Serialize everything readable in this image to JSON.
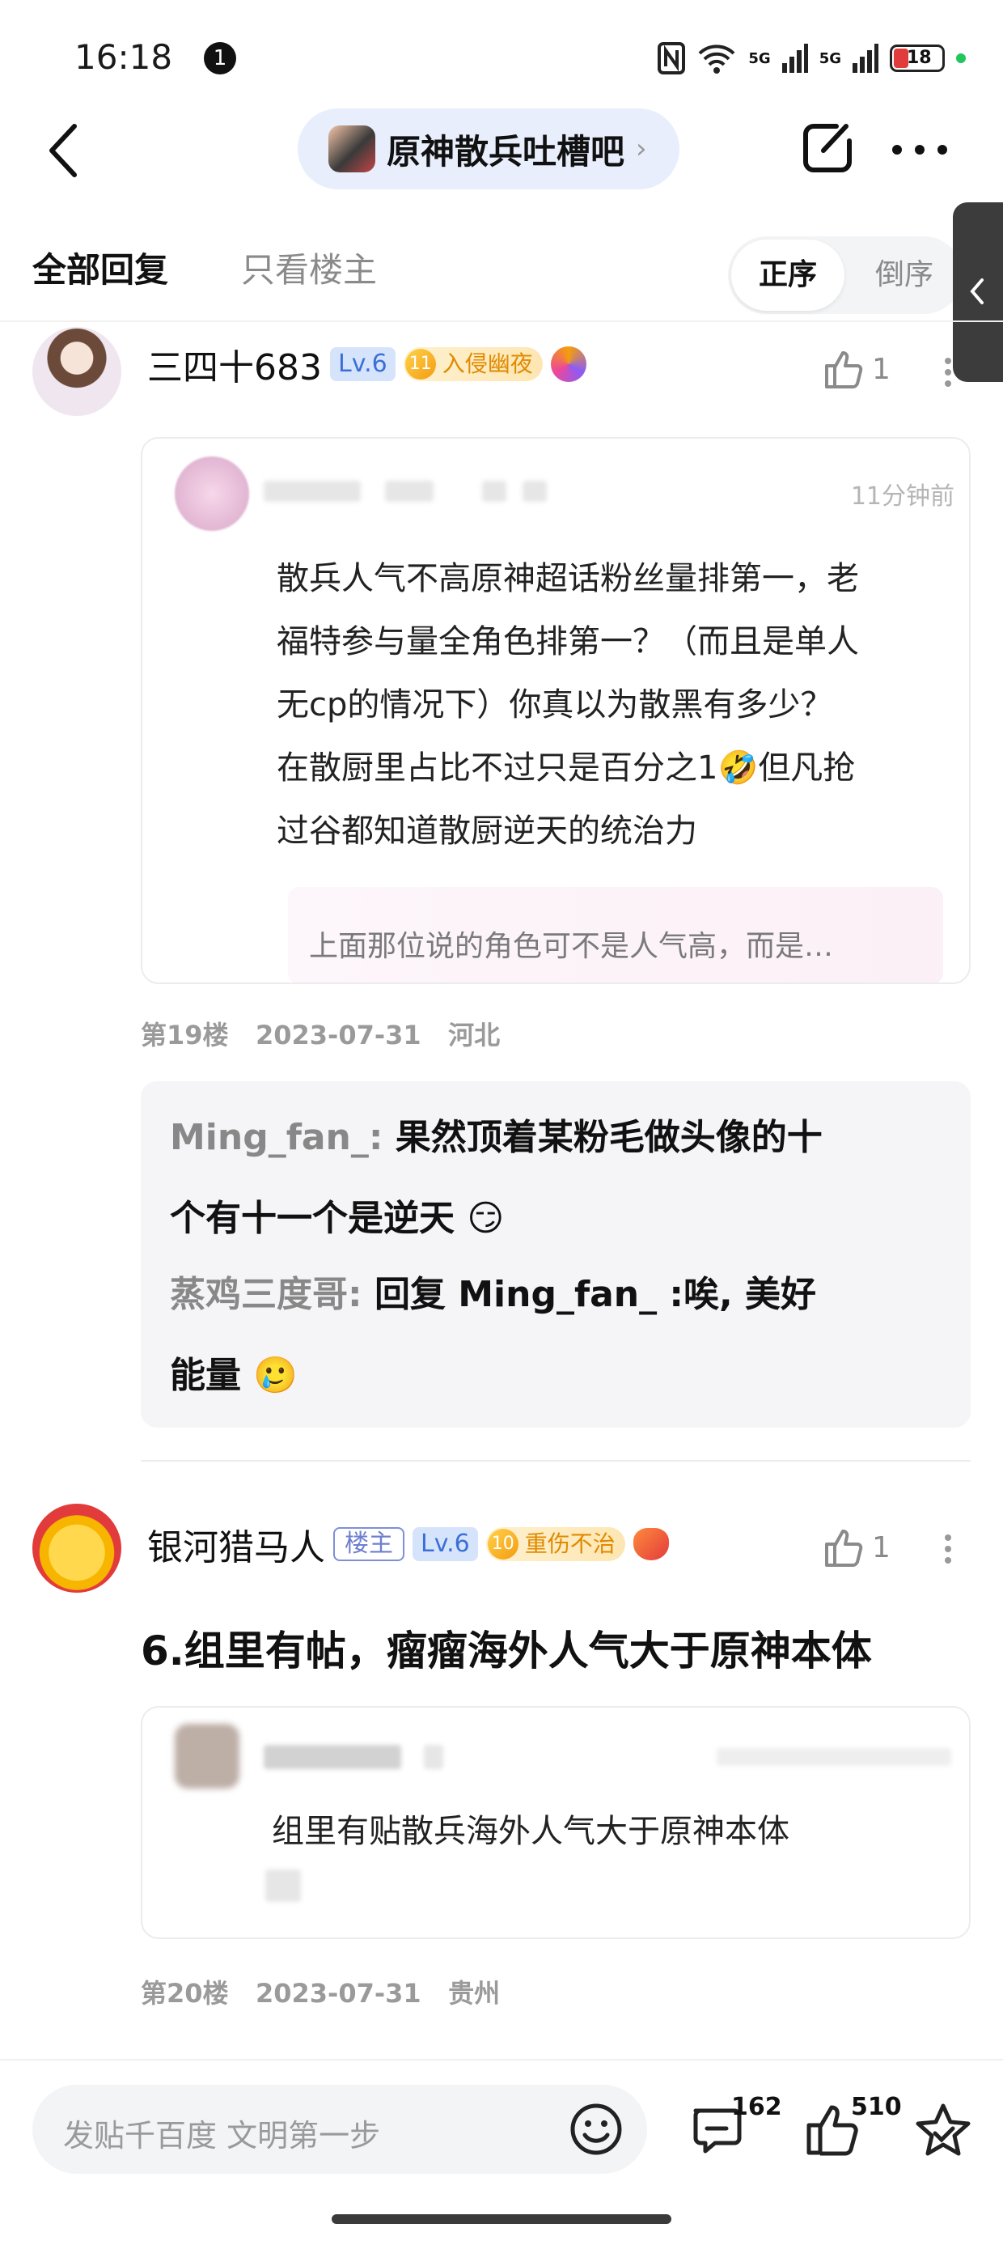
{
  "status_bar": {
    "time": "16:18",
    "notification_count": "1",
    "signal_1": "5G",
    "signal_2": "5G",
    "battery": "18"
  },
  "header": {
    "forum_name": "原神散兵吐槽吧",
    "chevron": "›"
  },
  "tabs": {
    "all_replies": "全部回复",
    "only_op": "只看楼主",
    "sort_asc": "正序",
    "sort_desc": "倒序"
  },
  "posts": [
    {
      "username": "三四十683",
      "level": "Lv.6",
      "badge_level": "11",
      "badge_text": "入侵幽夜",
      "likes": "1",
      "quote": {
        "time": "11分钟前",
        "lines": [
          "散兵人气不高原神超话粉丝量排第一，老",
          "福特参与量全角色排第一？（而且是单人",
          "无cp的情况下）你真以为散黑有多少？",
          "在散厨里占比不过只是百分之1🤣但凡抢",
          "过谷都知道散厨逆天的统治力"
        ],
        "faded_line": "上面那位说的角色可不是人气高，而是…"
      },
      "floor": "第19楼",
      "date": "2023-07-31",
      "location": "河北",
      "sub_replies": [
        {
          "name": "Ming_fan_:",
          "text": "果然顶着某粉毛做头像的十",
          "cont": "个有十一个是逆天 😏"
        },
        {
          "name": "蒸鸡三度哥:",
          "text": "回复 Ming_fan_ :唉, 美好",
          "cont": "能量 🥲"
        }
      ]
    },
    {
      "username": "银河猎马人",
      "op_tag": "楼主",
      "level": "Lv.6",
      "badge_level": "10",
      "badge_text": "重伤不治",
      "likes": "1",
      "title": "6.组里有帖，瘤瘤海外人气大于原神本体",
      "quote_text": "组里有贴散兵海外人气大于原神本体",
      "floor": "第20楼",
      "date": "2023-07-31",
      "location": "贵州"
    }
  ],
  "bottom": {
    "placeholder": "发贴千百度 文明第一步",
    "comment_count": "162",
    "like_count": "510"
  },
  "colors": {
    "accent_blue": "#3b6fd8",
    "badge_orange": "#e08a00",
    "pill_bg": "#e8eefc"
  }
}
